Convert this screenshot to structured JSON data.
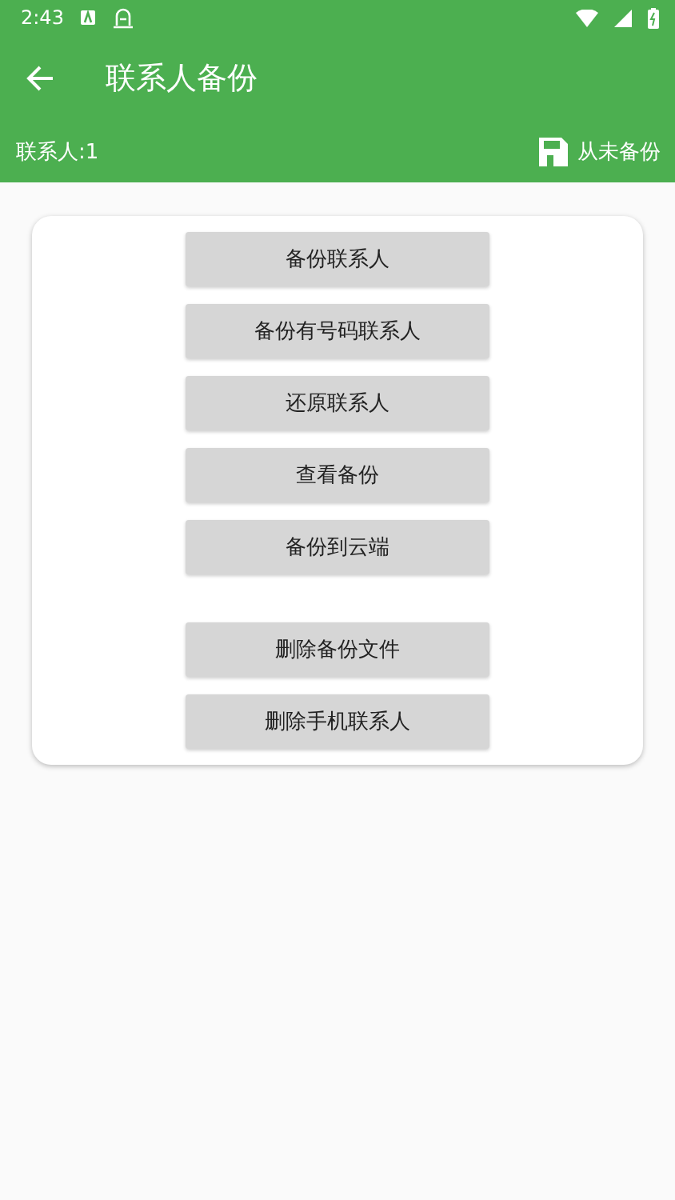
{
  "status_bar": {
    "time": "2:43"
  },
  "app_bar": {
    "title": "联系人备份"
  },
  "info_bar": {
    "contacts": "联系人:1",
    "backup_status": "从未备份"
  },
  "button_groups": [
    {
      "buttons": [
        "备份联系人",
        "备份有号码联系人",
        "还原联系人",
        "查看备份",
        "备份到云端"
      ]
    },
    {
      "buttons": [
        "删除备份文件",
        "删除手机联系人"
      ]
    }
  ]
}
